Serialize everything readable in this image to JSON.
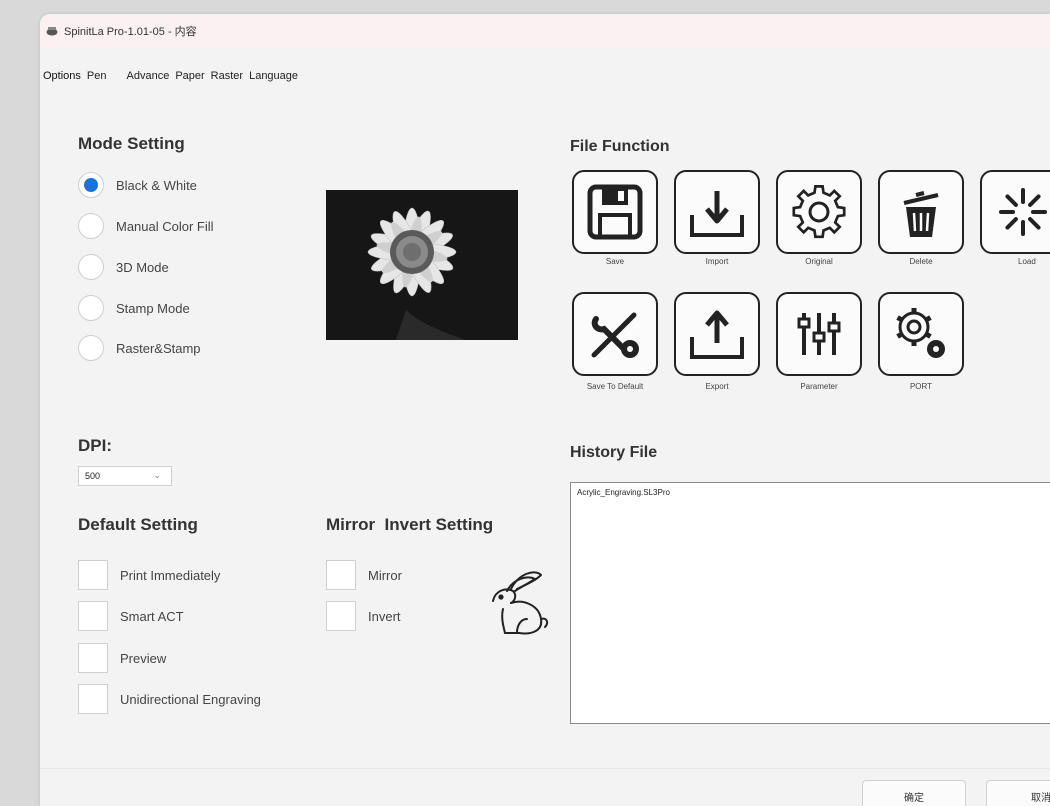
{
  "window": {
    "title": "SpinitLa Pro-1.01-05 - 内容"
  },
  "tabs": [
    {
      "label": "Options"
    },
    {
      "label": "Pen"
    },
    {
      "label": "Advance"
    },
    {
      "label": "Paper"
    },
    {
      "label": "Raster"
    },
    {
      "label": "Language"
    }
  ],
  "mode_setting": {
    "title": "Mode Setting",
    "selected": "Black & White",
    "options": [
      {
        "label": "Black & White"
      },
      {
        "label": "Manual Color Fill"
      },
      {
        "label": "3D Mode"
      },
      {
        "label": "Stamp Mode"
      },
      {
        "label": "Raster&Stamp"
      }
    ]
  },
  "dpi": {
    "label": "DPI:",
    "value": "500"
  },
  "default_setting": {
    "title": "Default Setting",
    "items": [
      {
        "label": "Print Immediately"
      },
      {
        "label": "Smart ACT"
      },
      {
        "label": "Preview"
      },
      {
        "label": "Unidirectional Engraving"
      }
    ]
  },
  "mirror_invert": {
    "title": "Mirror  Invert Setting",
    "items": [
      {
        "label": "Mirror"
      },
      {
        "label": "Invert"
      }
    ]
  },
  "file_function": {
    "title": "File Function",
    "buttons": [
      {
        "label": "Save",
        "icon": "floppy-disk-icon"
      },
      {
        "label": "Import",
        "icon": "import-icon"
      },
      {
        "label": "Original",
        "icon": "gear-icon"
      },
      {
        "label": "Delete",
        "icon": "trash-icon"
      },
      {
        "label": "Load",
        "icon": "loading-spinner-icon"
      },
      {
        "label": "Save To Default",
        "icon": "tools-icon"
      },
      {
        "label": "Export",
        "icon": "export-icon"
      },
      {
        "label": "Parameter",
        "icon": "sliders-icon"
      },
      {
        "label": "PORT",
        "icon": "gears-icon"
      }
    ]
  },
  "history": {
    "title": "History File",
    "files": [
      "Acrylic_Engraving.SL3Pro"
    ]
  },
  "footer": {
    "ok_label": "确定",
    "cancel_label": "取消"
  }
}
